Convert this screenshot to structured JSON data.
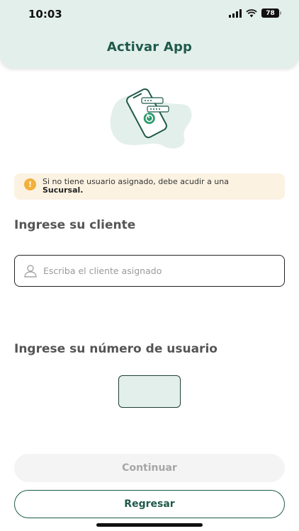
{
  "status_bar": {
    "time": "10:03",
    "battery": "78",
    "icons": [
      "signal-icon",
      "wifi-icon",
      "battery-icon"
    ]
  },
  "header": {
    "title": "Activar App"
  },
  "illustration": {
    "icon": "phone-power-illustration"
  },
  "info_banner": {
    "icon": "exclamation-icon",
    "text": "Si no tiene usuario asignado, debe acudir a una ",
    "text_bold": "Sucursal."
  },
  "client_section": {
    "title": "Ingrese su cliente",
    "placeholder": "Escriba el cliente asignado",
    "value": "",
    "icon": "user-icon"
  },
  "user_section": {
    "title": "Ingrese su número de usuario",
    "value": ""
  },
  "actions": {
    "continue_label": "Continuar",
    "back_label": "Regresar"
  },
  "colors": {
    "primary": "#1f5a4a",
    "header_bg": "#e3efeb",
    "warning": "#f2b13d",
    "banner_bg": "#fcf2e2"
  }
}
